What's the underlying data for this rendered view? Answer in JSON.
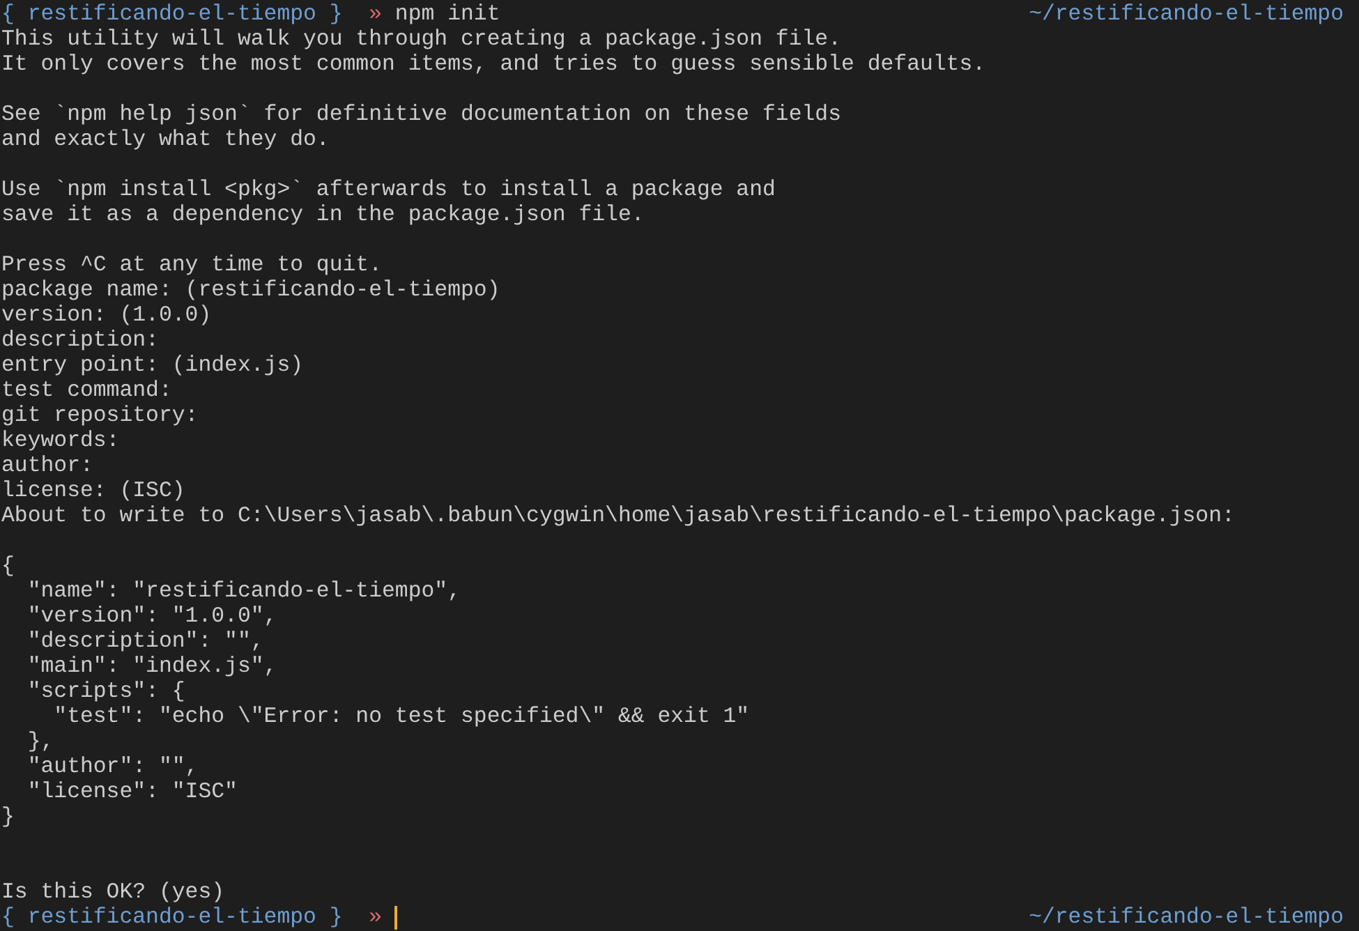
{
  "terminal": {
    "lines": [
      {
        "kind": "prompt",
        "directory": "{ restificando-el-tiempo }",
        "symbol": "»",
        "command": "npm init",
        "path": "~/restificando-el-tiempo",
        "cursor": false
      },
      {
        "kind": "output",
        "text": "This utility will walk you through creating a package.json file."
      },
      {
        "kind": "output",
        "text": "It only covers the most common items, and tries to guess sensible defaults."
      },
      {
        "kind": "blank"
      },
      {
        "kind": "output",
        "text": "See `npm help json` for definitive documentation on these fields"
      },
      {
        "kind": "output",
        "text": "and exactly what they do."
      },
      {
        "kind": "blank"
      },
      {
        "kind": "output",
        "text": "Use `npm install <pkg>` afterwards to install a package and"
      },
      {
        "kind": "output",
        "text": "save it as a dependency in the package.json file."
      },
      {
        "kind": "blank"
      },
      {
        "kind": "output",
        "text": "Press ^C at any time to quit."
      },
      {
        "kind": "output",
        "text": "package name: (restificando-el-tiempo)"
      },
      {
        "kind": "output",
        "text": "version: (1.0.0)"
      },
      {
        "kind": "output",
        "text": "description:"
      },
      {
        "kind": "output",
        "text": "entry point: (index.js)"
      },
      {
        "kind": "output",
        "text": "test command:"
      },
      {
        "kind": "output",
        "text": "git repository:"
      },
      {
        "kind": "output",
        "text": "keywords:"
      },
      {
        "kind": "output",
        "text": "author:"
      },
      {
        "kind": "output",
        "text": "license: (ISC)"
      },
      {
        "kind": "output",
        "text": "About to write to C:\\Users\\jasab\\.babun\\cygwin\\home\\jasab\\restificando-el-tiempo\\package.json:"
      },
      {
        "kind": "blank"
      },
      {
        "kind": "output",
        "text": "{"
      },
      {
        "kind": "output",
        "text": "  \"name\": \"restificando-el-tiempo\","
      },
      {
        "kind": "output",
        "text": "  \"version\": \"1.0.0\","
      },
      {
        "kind": "output",
        "text": "  \"description\": \"\","
      },
      {
        "kind": "output",
        "text": "  \"main\": \"index.js\","
      },
      {
        "kind": "output",
        "text": "  \"scripts\": {"
      },
      {
        "kind": "output",
        "text": "    \"test\": \"echo \\\"Error: no test specified\\\" && exit 1\""
      },
      {
        "kind": "output",
        "text": "  },"
      },
      {
        "kind": "output",
        "text": "  \"author\": \"\","
      },
      {
        "kind": "output",
        "text": "  \"license\": \"ISC\""
      },
      {
        "kind": "output",
        "text": "}"
      },
      {
        "kind": "blank"
      },
      {
        "kind": "blank"
      },
      {
        "kind": "output",
        "text": "Is this OK? (yes)"
      },
      {
        "kind": "prompt",
        "directory": "{ restificando-el-tiempo }",
        "symbol": "»",
        "path": "~/restificando-el-tiempo",
        "cursor": true
      }
    ]
  }
}
